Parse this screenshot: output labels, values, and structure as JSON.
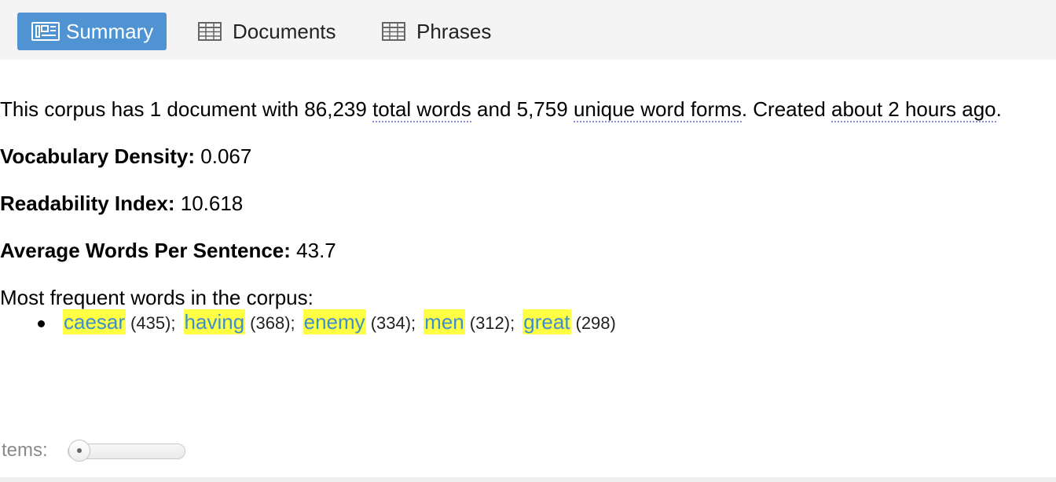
{
  "tabs": [
    {
      "label": "Summary",
      "icon": "summary-icon",
      "active": true
    },
    {
      "label": "Documents",
      "icon": "table-icon",
      "active": false
    },
    {
      "label": "Phrases",
      "icon": "table-icon",
      "active": false
    }
  ],
  "summary": {
    "intro_prefix": "This corpus has 1 document with ",
    "total_words_value": "86,239",
    "total_words_label": "total words",
    "intro_mid": " and ",
    "unique_value": "5,759",
    "unique_label": "unique word forms",
    "intro_created": ". Created ",
    "created_ago": "about 2 hours ago",
    "intro_end": "."
  },
  "stats": {
    "density_label": "Vocabulary Density:",
    "density_value": "0.067",
    "readability_label": "Readability Index:",
    "readability_value": "10.618",
    "avg_label": "Average Words Per Sentence:",
    "avg_value": "43.7"
  },
  "frequent": {
    "heading": "Most frequent words in the corpus:",
    "terms": [
      {
        "term": "caesar",
        "count": "(435)"
      },
      {
        "term": "having",
        "count": "(368)"
      },
      {
        "term": "enemy",
        "count": "(334)"
      },
      {
        "term": "men",
        "count": "(312)"
      },
      {
        "term": "great",
        "count": "(298)"
      }
    ]
  },
  "footer": {
    "items_label": "tems:",
    "items_slider_value": 0
  },
  "colors": {
    "active_tab": "#4f93d3",
    "term_highlight": "#ffff44",
    "term_text": "#3c8fd0"
  }
}
